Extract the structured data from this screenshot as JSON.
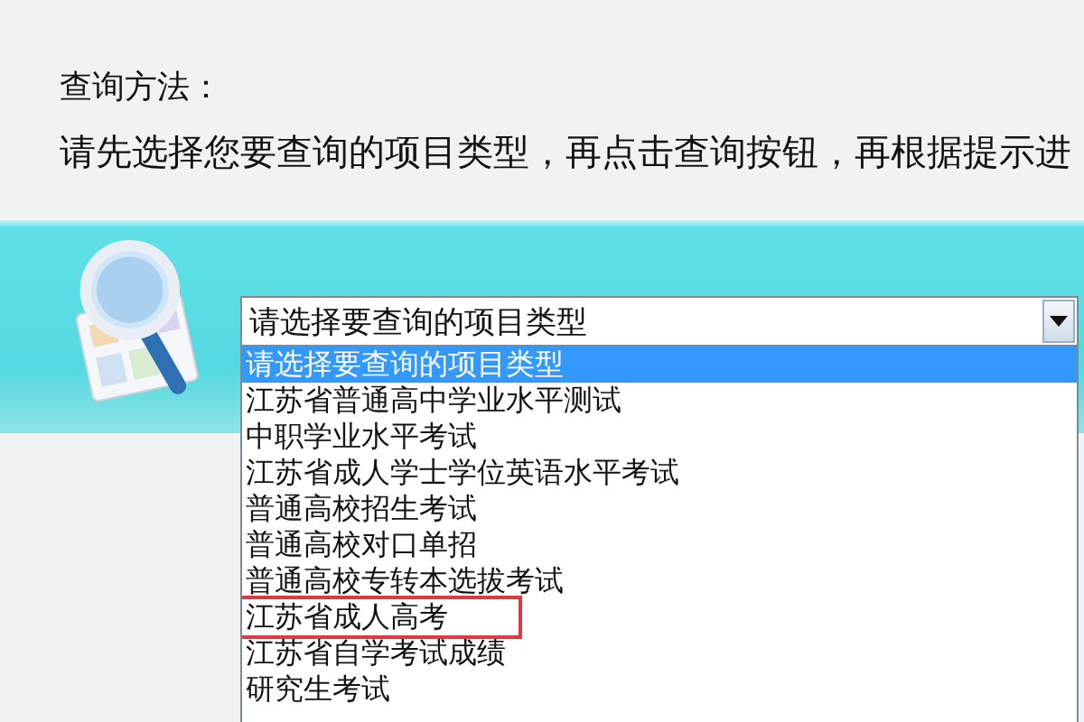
{
  "instructions": {
    "heading": "查询方法：",
    "text": "请先选择您要查询的项目类型，再点击查询按钮，再根据提示进"
  },
  "select": {
    "value": "请选择要查询的项目类型",
    "expanded": true
  },
  "options": [
    {
      "label": "请选择要查询的项目类型",
      "selected": true,
      "highlighted": false
    },
    {
      "label": "江苏省普通高中学业水平测试",
      "selected": false,
      "highlighted": false
    },
    {
      "label": "中职学业水平考试",
      "selected": false,
      "highlighted": false
    },
    {
      "label": "江苏省成人学士学位英语水平考试",
      "selected": false,
      "highlighted": false
    },
    {
      "label": "普通高校招生考试",
      "selected": false,
      "highlighted": false
    },
    {
      "label": "普通高校对口单招",
      "selected": false,
      "highlighted": false
    },
    {
      "label": "普通高校专转本选拔考试",
      "selected": false,
      "highlighted": false
    },
    {
      "label": "江苏省成人高考",
      "selected": false,
      "highlighted": true
    },
    {
      "label": "江苏省自学考试成绩",
      "selected": false,
      "highlighted": false
    },
    {
      "label": "研究生考试",
      "selected": false,
      "highlighted": false
    }
  ]
}
